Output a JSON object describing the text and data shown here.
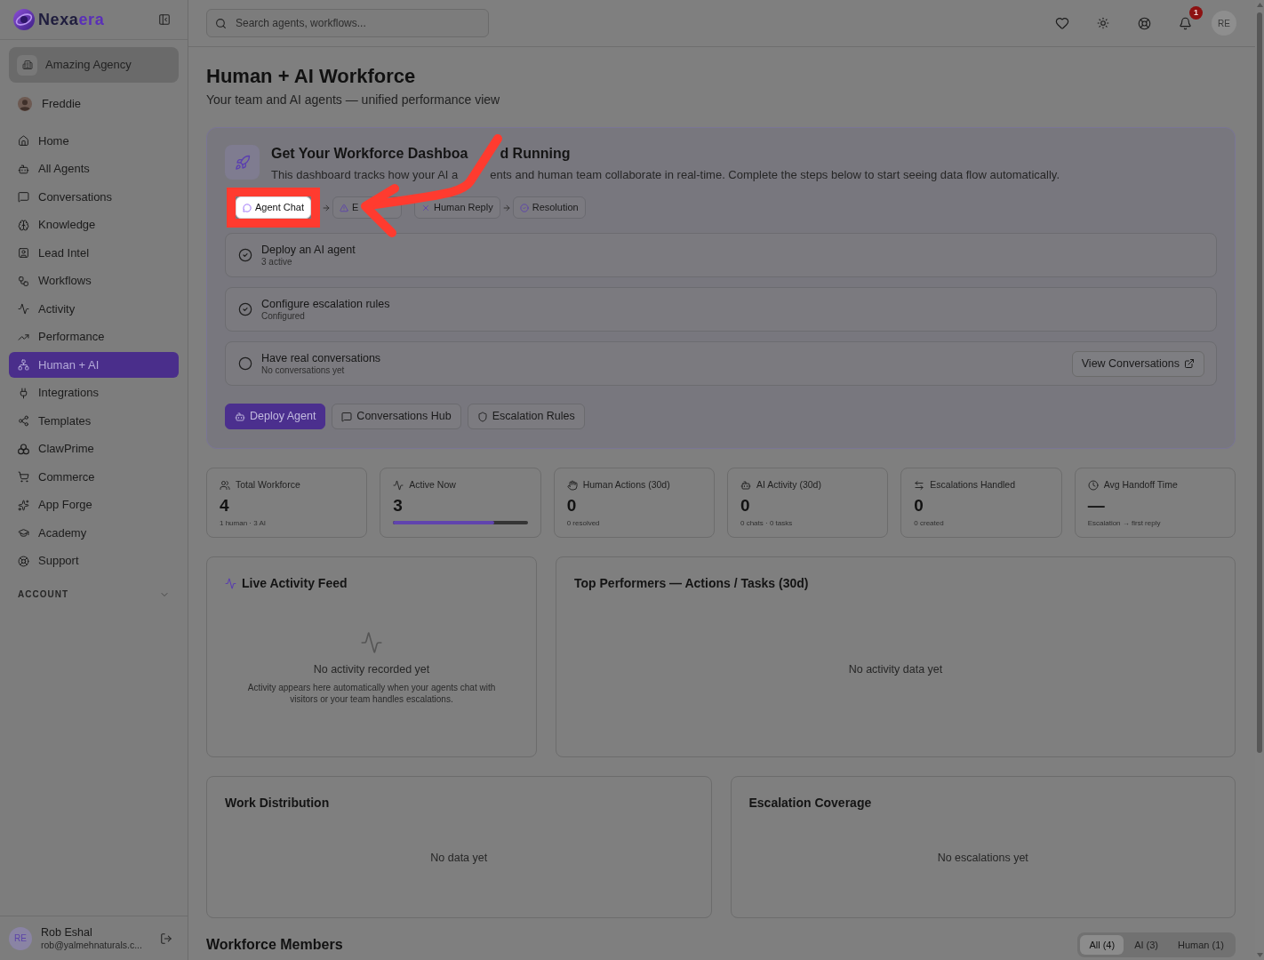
{
  "sidebar": {
    "logo": {
      "text_dark": "Nexa",
      "text_accent": "era"
    },
    "workspace": {
      "name": "Amazing Agency"
    },
    "profile": {
      "name": "Freddie"
    },
    "nav": [
      {
        "label": "Home",
        "selected": false
      },
      {
        "label": "All Agents",
        "selected": false
      },
      {
        "label": "Conversations",
        "selected": false
      },
      {
        "label": "Knowledge",
        "selected": false
      },
      {
        "label": "Lead Intel",
        "selected": false
      },
      {
        "label": "Workflows",
        "selected": false
      },
      {
        "label": "Activity",
        "selected": false
      },
      {
        "label": "Performance",
        "selected": false
      },
      {
        "label": "Human + AI",
        "selected": true
      },
      {
        "label": "Integrations",
        "selected": false
      },
      {
        "label": "Templates",
        "selected": false
      },
      {
        "label": "ClawPrime",
        "selected": false
      },
      {
        "label": "Commerce",
        "selected": false
      },
      {
        "label": "App Forge",
        "selected": false
      },
      {
        "label": "Academy",
        "selected": false
      },
      {
        "label": "Support",
        "selected": false
      }
    ],
    "section": {
      "label": "ACCOUNT",
      "expanded": false
    },
    "user": {
      "initials": "RE",
      "name": "Rob Eshal",
      "email": "rob@yalmehnaturals.c..."
    }
  },
  "header": {
    "search": {
      "placeholder": "Search agents, workflows..."
    },
    "notifications": {
      "count": "1"
    },
    "avatar": {
      "initials": "RE"
    }
  },
  "page": {
    "title": "Human + AI Workforce",
    "subtitle": "Your team and AI agents — unified performance view"
  },
  "onboarding": {
    "title_parts": [
      "Get Your Workforce Dashboa",
      "d Running"
    ],
    "description_parts": [
      "This dashboard tracks how your AI a",
      "ents and human team collaborate in real-time. Complete the steps below to start seeing data flow automatically."
    ],
    "flow": [
      {
        "label": "Agent Chat",
        "highlighted": true,
        "arrow_before": false
      },
      {
        "label": "E",
        "highlighted": false,
        "arrow_before": true
      },
      {
        "label": "Human Reply",
        "highlighted": false,
        "arrow_before": false
      },
      {
        "label": "Resolution",
        "highlighted": false,
        "arrow_before": true
      }
    ],
    "steps": [
      {
        "title": "Deploy an AI agent",
        "status": "3 active",
        "done": true
      },
      {
        "title": "Configure escalation rules",
        "status": "Configured",
        "done": true
      },
      {
        "title": "Have real conversations",
        "status": "No conversations yet",
        "done": false,
        "action": "View Conversations"
      }
    ],
    "buttons": [
      {
        "label": "Deploy Agent",
        "kind": "primary"
      },
      {
        "label": "Conversations Hub",
        "kind": "secondary"
      },
      {
        "label": "Escalation Rules",
        "kind": "secondary"
      }
    ]
  },
  "stats": [
    {
      "label": "Total Workforce",
      "value": "4",
      "detail": "1 human · 3 AI"
    },
    {
      "label": "Active Now",
      "value": "3",
      "level": 0.75
    },
    {
      "label": "Human Actions (30d)",
      "value": "0",
      "detail": "0 resolved"
    },
    {
      "label": "AI Activity (30d)",
      "value": "0",
      "detail": "0 chats · 0 tasks"
    },
    {
      "label": "Escalations Handled",
      "value": "0",
      "detail": "0 created"
    },
    {
      "label": "Avg Handoff Time",
      "value": "—",
      "detail": "Escalation → first reply"
    }
  ],
  "panels": [
    {
      "kind": "feed",
      "title": "Live Activity Feed",
      "empty_title": "No activity recorded yet",
      "empty_text": "Activity appears here automatically when your agents chat with visitors or your team handles escalations."
    },
    {
      "kind": "chart",
      "title": "Top Performers — Actions / Tasks (30d)",
      "empty_title": "No activity data yet"
    },
    {
      "kind": "chart",
      "title": "Work Distribution",
      "empty_title": "No data yet"
    },
    {
      "kind": "chart",
      "title": "Escalation Coverage",
      "empty_title": "No escalations yet"
    }
  ],
  "members": {
    "title": "Workforce Members",
    "filters": [
      {
        "label": "All (4)",
        "selected": true
      },
      {
        "label": "AI (3)",
        "selected": false
      },
      {
        "label": "Human (1)",
        "selected": false
      }
    ]
  }
}
